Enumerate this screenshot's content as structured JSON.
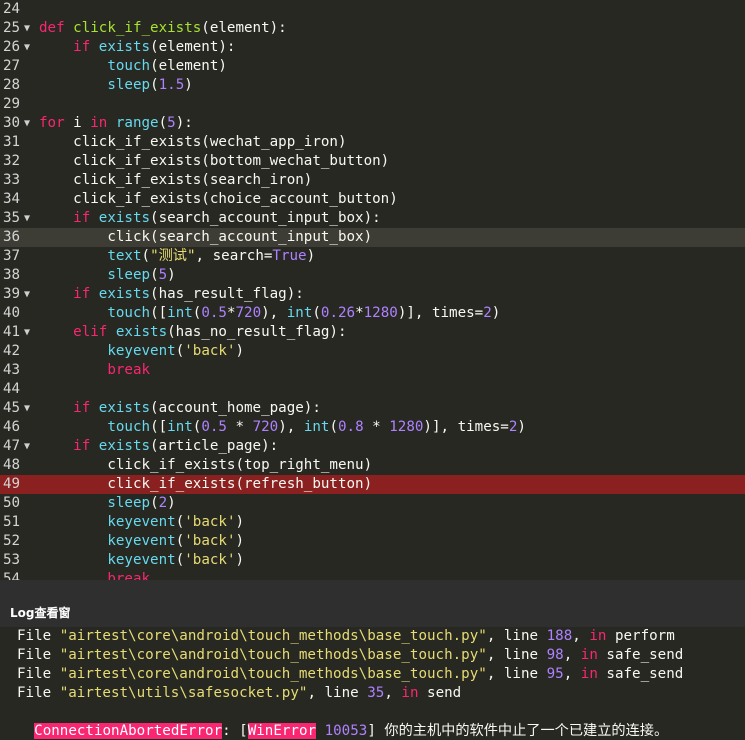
{
  "editor": {
    "lines": [
      {
        "n": "24",
        "fold": false,
        "type": "normal",
        "tokens": []
      },
      {
        "n": "25",
        "fold": true,
        "type": "normal",
        "tokens": [
          [
            "kw",
            "def "
          ],
          [
            "fn",
            "click_if_exists"
          ],
          [
            "plain",
            "(element):"
          ]
        ]
      },
      {
        "n": "26",
        "fold": true,
        "type": "normal",
        "tokens": [
          [
            "plain",
            "    "
          ],
          [
            "kw",
            "if "
          ],
          [
            "bi",
            "exists"
          ],
          [
            "plain",
            "(element):"
          ]
        ]
      },
      {
        "n": "27",
        "fold": false,
        "type": "normal",
        "tokens": [
          [
            "plain",
            "        "
          ],
          [
            "bi",
            "touch"
          ],
          [
            "plain",
            "(element)"
          ]
        ]
      },
      {
        "n": "28",
        "fold": false,
        "type": "normal",
        "tokens": [
          [
            "plain",
            "        "
          ],
          [
            "bi",
            "sleep"
          ],
          [
            "plain",
            "("
          ],
          [
            "num",
            "1.5"
          ],
          [
            "plain",
            ")"
          ]
        ]
      },
      {
        "n": "29",
        "fold": false,
        "type": "normal",
        "tokens": []
      },
      {
        "n": "30",
        "fold": true,
        "type": "normal",
        "tokens": [
          [
            "kw",
            "for "
          ],
          [
            "plain",
            "i "
          ],
          [
            "kw",
            "in "
          ],
          [
            "bi",
            "range"
          ],
          [
            "plain",
            "("
          ],
          [
            "num",
            "5"
          ],
          [
            "plain",
            "):"
          ]
        ]
      },
      {
        "n": "31",
        "fold": false,
        "type": "normal",
        "tokens": [
          [
            "plain",
            "    click_if_exists(wechat_app_iron)"
          ]
        ]
      },
      {
        "n": "32",
        "fold": false,
        "type": "normal",
        "tokens": [
          [
            "plain",
            "    click_if_exists(bottom_wechat_button)"
          ]
        ]
      },
      {
        "n": "33",
        "fold": false,
        "type": "normal",
        "tokens": [
          [
            "plain",
            "    click_if_exists(search_iron)"
          ]
        ]
      },
      {
        "n": "34",
        "fold": false,
        "type": "normal",
        "tokens": [
          [
            "plain",
            "    click_if_exists(choice_account_button)"
          ]
        ]
      },
      {
        "n": "35",
        "fold": true,
        "type": "normal",
        "tokens": [
          [
            "plain",
            "    "
          ],
          [
            "kw",
            "if "
          ],
          [
            "bi",
            "exists"
          ],
          [
            "plain",
            "(search_account_input_box):"
          ]
        ]
      },
      {
        "n": "36",
        "fold": false,
        "type": "current",
        "tokens": [
          [
            "plain",
            "        click(search_account_input_box)"
          ]
        ]
      },
      {
        "n": "37",
        "fold": false,
        "type": "normal",
        "tokens": [
          [
            "plain",
            "        "
          ],
          [
            "bi",
            "text"
          ],
          [
            "plain",
            "("
          ],
          [
            "str",
            "\"测试\""
          ],
          [
            "plain",
            ", search="
          ],
          [
            "cst",
            "True"
          ],
          [
            "plain",
            ")"
          ]
        ]
      },
      {
        "n": "38",
        "fold": false,
        "type": "normal",
        "tokens": [
          [
            "plain",
            "        "
          ],
          [
            "bi",
            "sleep"
          ],
          [
            "plain",
            "("
          ],
          [
            "num",
            "5"
          ],
          [
            "plain",
            ")"
          ]
        ]
      },
      {
        "n": "39",
        "fold": true,
        "type": "normal",
        "tokens": [
          [
            "plain",
            "    "
          ],
          [
            "kw",
            "if "
          ],
          [
            "bi",
            "exists"
          ],
          [
            "plain",
            "(has_result_flag):"
          ]
        ]
      },
      {
        "n": "40",
        "fold": false,
        "type": "normal",
        "tokens": [
          [
            "plain",
            "        "
          ],
          [
            "bi",
            "touch"
          ],
          [
            "plain",
            "(["
          ],
          [
            "bi",
            "int"
          ],
          [
            "plain",
            "("
          ],
          [
            "num",
            "0.5"
          ],
          [
            "plain",
            "*"
          ],
          [
            "num",
            "720"
          ],
          [
            "plain",
            "), "
          ],
          [
            "bi",
            "int"
          ],
          [
            "plain",
            "("
          ],
          [
            "num",
            "0.26"
          ],
          [
            "plain",
            "*"
          ],
          [
            "num",
            "1280"
          ],
          [
            "plain",
            ")], times="
          ],
          [
            "num",
            "2"
          ],
          [
            "plain",
            ")"
          ]
        ]
      },
      {
        "n": "41",
        "fold": true,
        "type": "normal",
        "tokens": [
          [
            "plain",
            "    "
          ],
          [
            "kw",
            "elif "
          ],
          [
            "bi",
            "exists"
          ],
          [
            "plain",
            "(has_no_result_flag):"
          ]
        ]
      },
      {
        "n": "42",
        "fold": false,
        "type": "normal",
        "tokens": [
          [
            "plain",
            "        "
          ],
          [
            "bi",
            "keyevent"
          ],
          [
            "plain",
            "("
          ],
          [
            "str",
            "'back'"
          ],
          [
            "plain",
            ")"
          ]
        ]
      },
      {
        "n": "43",
        "fold": false,
        "type": "normal",
        "tokens": [
          [
            "plain",
            "        "
          ],
          [
            "kw",
            "break"
          ]
        ]
      },
      {
        "n": "44",
        "fold": false,
        "type": "normal",
        "tokens": []
      },
      {
        "n": "45",
        "fold": true,
        "type": "normal",
        "tokens": [
          [
            "plain",
            "    "
          ],
          [
            "kw",
            "if "
          ],
          [
            "bi",
            "exists"
          ],
          [
            "plain",
            "(account_home_page):"
          ]
        ]
      },
      {
        "n": "46",
        "fold": false,
        "type": "normal",
        "tokens": [
          [
            "plain",
            "        "
          ],
          [
            "bi",
            "touch"
          ],
          [
            "plain",
            "(["
          ],
          [
            "bi",
            "int"
          ],
          [
            "plain",
            "("
          ],
          [
            "num",
            "0.5"
          ],
          [
            "plain",
            " * "
          ],
          [
            "num",
            "720"
          ],
          [
            "plain",
            "), "
          ],
          [
            "bi",
            "int"
          ],
          [
            "plain",
            "("
          ],
          [
            "num",
            "0.8"
          ],
          [
            "plain",
            " * "
          ],
          [
            "num",
            "1280"
          ],
          [
            "plain",
            ")], times="
          ],
          [
            "num",
            "2"
          ],
          [
            "plain",
            ")"
          ]
        ]
      },
      {
        "n": "47",
        "fold": true,
        "type": "normal",
        "tokens": [
          [
            "plain",
            "    "
          ],
          [
            "kw",
            "if "
          ],
          [
            "bi",
            "exists"
          ],
          [
            "plain",
            "(article_page):"
          ]
        ]
      },
      {
        "n": "48",
        "fold": false,
        "type": "normal",
        "tokens": [
          [
            "plain",
            "        click_if_exists(top_right_menu)"
          ]
        ]
      },
      {
        "n": "49",
        "fold": false,
        "type": "breakpoint",
        "tokens": [
          [
            "plain",
            "        click_if_exists(refresh_button)"
          ]
        ]
      },
      {
        "n": "50",
        "fold": false,
        "type": "normal",
        "tokens": [
          [
            "plain",
            "        "
          ],
          [
            "bi",
            "sleep"
          ],
          [
            "plain",
            "("
          ],
          [
            "num",
            "2"
          ],
          [
            "plain",
            ")"
          ]
        ]
      },
      {
        "n": "51",
        "fold": false,
        "type": "normal",
        "tokens": [
          [
            "plain",
            "        "
          ],
          [
            "bi",
            "keyevent"
          ],
          [
            "plain",
            "("
          ],
          [
            "str",
            "'back'"
          ],
          [
            "plain",
            ")"
          ]
        ]
      },
      {
        "n": "52",
        "fold": false,
        "type": "normal",
        "tokens": [
          [
            "plain",
            "        "
          ],
          [
            "bi",
            "keyevent"
          ],
          [
            "plain",
            "("
          ],
          [
            "str",
            "'back'"
          ],
          [
            "plain",
            ")"
          ]
        ]
      },
      {
        "n": "53",
        "fold": false,
        "type": "normal",
        "tokens": [
          [
            "plain",
            "        "
          ],
          [
            "bi",
            "keyevent"
          ],
          [
            "plain",
            "("
          ],
          [
            "str",
            "'back'"
          ],
          [
            "plain",
            ")"
          ]
        ]
      },
      {
        "n": "54",
        "fold": false,
        "type": "normal",
        "tokens": [
          [
            "plain",
            "        "
          ],
          [
            "kw",
            "break"
          ]
        ]
      }
    ]
  },
  "log": {
    "title": "Log查看窗",
    "lines": [
      {
        "tokens": [
          [
            "plain",
            "File "
          ],
          [
            "str",
            "\"airtest\\core\\android\\touch_methods\\base_touch.py\""
          ],
          [
            "plain",
            ", line "
          ],
          [
            "num",
            "188"
          ],
          [
            "plain",
            ", "
          ],
          [
            "kw",
            "in"
          ],
          [
            "plain",
            " perform"
          ]
        ]
      },
      {
        "tokens": [
          [
            "plain",
            "File "
          ],
          [
            "str",
            "\"airtest\\core\\android\\touch_methods\\base_touch.py\""
          ],
          [
            "plain",
            ", line "
          ],
          [
            "num",
            "98"
          ],
          [
            "plain",
            ", "
          ],
          [
            "kw",
            "in"
          ],
          [
            "plain",
            " safe_send"
          ]
        ]
      },
      {
        "tokens": [
          [
            "plain",
            "File "
          ],
          [
            "str",
            "\"airtest\\core\\android\\touch_methods\\base_touch.py\""
          ],
          [
            "plain",
            ", line "
          ],
          [
            "num",
            "95"
          ],
          [
            "plain",
            ", "
          ],
          [
            "kw",
            "in"
          ],
          [
            "plain",
            " safe_send"
          ]
        ]
      },
      {
        "tokens": [
          [
            "plain",
            "File "
          ],
          [
            "str",
            "\"airtest\\utils\\safesocket.py\""
          ],
          [
            "plain",
            ", line "
          ],
          [
            "num",
            "35"
          ],
          [
            "plain",
            ", "
          ],
          [
            "kw",
            "in"
          ],
          [
            "plain",
            " send"
          ]
        ]
      }
    ],
    "error": {
      "name": "ConnectionAbortedError",
      "sep": ": [",
      "win_error": "WinError",
      "code": " 10053",
      "message": "] 你的主机中的软件中止了一个已建立的连接。"
    }
  }
}
